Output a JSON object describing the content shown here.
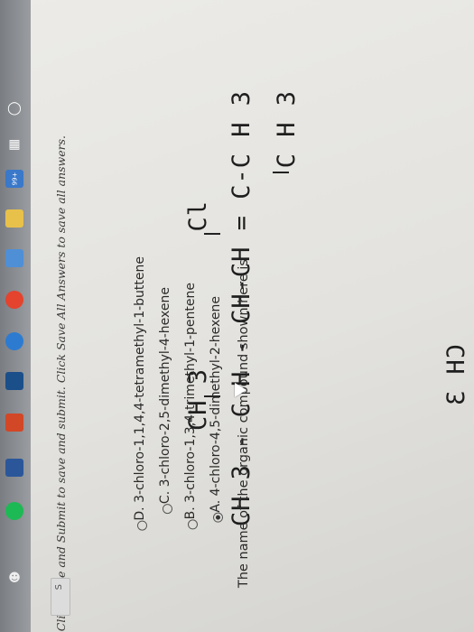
{
  "formula": {
    "top_sub_left": "CH 3",
    "top_sub_right": "Cl",
    "main_chain": "CH 3 - C H - CH-CH = C-C H 3",
    "bottom_sub": "C H 3"
  },
  "question": {
    "text": "The name of the organic compound shown here is",
    "options": [
      {
        "label": "A. 4-chloro-4,5-dimethyl-2-hexene",
        "selected": true
      },
      {
        "label": "B. 3-chloro-1,3,4-trimethyl-1-pentene",
        "selected": false
      },
      {
        "label": "C. 3-chloro-2,5-dimethyl-4-hexene",
        "selected": false
      },
      {
        "label": "D. 3-chloro-1,1,4,4-tetramethyl-1-buttene",
        "selected": false
      }
    ]
  },
  "footer": {
    "hint": "Click Save and Submit to save and submit. Click Save All Answers to save all answers.",
    "save_button": "S"
  },
  "taskbar": {
    "badge": "99+",
    "icons": [
      "clock-icon",
      "task-view-icon",
      "mail-icon",
      "file-explorer-icon",
      "store-icon",
      "chrome-icon",
      "edge-icon",
      "photoshop-icon",
      "powerpoint-icon",
      "word-icon",
      "spotify-icon",
      "people-icon"
    ]
  },
  "colors": {
    "selected_radio": "#333333",
    "text": "#2a2a2a"
  }
}
